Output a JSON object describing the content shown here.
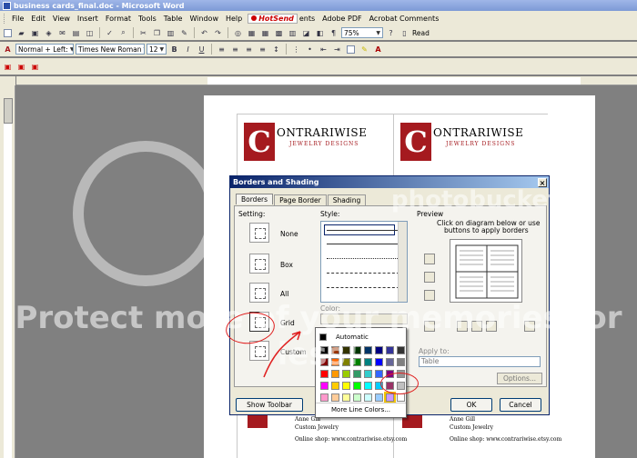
{
  "window": {
    "title": "business cards_final.doc - Microsoft Word"
  },
  "menu": {
    "items": [
      "File",
      "Edit",
      "View",
      "Insert",
      "Format",
      "Tools",
      "Table",
      "Window",
      "Help"
    ],
    "hotsend": "HotSend",
    "trailing": [
      "ents",
      "Adobe PDF",
      "Acrobat Comments"
    ]
  },
  "toolbar1": {
    "zoom": "75%",
    "read_label": "Read"
  },
  "toolbar2": {
    "style": "Normal + Left:",
    "font": "Times New Roman",
    "size": "12"
  },
  "document": {
    "card_logo_letter": "C",
    "card_brand": "ONTRARIWISE",
    "card_tagline": "JEWELRY DESIGNS",
    "bottom_left": [
      "Anne Gill",
      "Custom Jewelry",
      "",
      "Online shop: www.contrariwise.etsy.com"
    ],
    "bottom_right": [
      "Anne Gill",
      "Custom Jewelry",
      "",
      "Online shop: www.contrariwise.etsy.com"
    ]
  },
  "dialog": {
    "title": "Borders and Shading",
    "close": "×",
    "tabs": [
      "Borders",
      "Page Border",
      "Shading"
    ],
    "setting_label": "Setting:",
    "settings": [
      "None",
      "Box",
      "All",
      "Grid",
      "Custom"
    ],
    "style_label": "Style:",
    "color_label": "Color:",
    "preview_label": "Preview",
    "preview_hint": [
      "Click on diagram below or use",
      "buttons to apply borders"
    ],
    "apply_label": "Apply to:",
    "apply_value": "Table",
    "options_label": "Options...",
    "show_toolbar": "Show Toolbar",
    "ok": "OK",
    "cancel": "Cancel"
  },
  "palette": {
    "automatic": "Automatic",
    "more": "More Line Colors...",
    "colors": [
      "#000000",
      "#993300",
      "#333300",
      "#003300",
      "#003366",
      "#000080",
      "#333399",
      "#333333",
      "#800000",
      "#ff6600",
      "#808000",
      "#008000",
      "#008080",
      "#0000ff",
      "#666699",
      "#808080",
      "#ff0000",
      "#ff9900",
      "#99cc00",
      "#339966",
      "#33cccc",
      "#3366ff",
      "#800080",
      "#969696",
      "#ff00ff",
      "#ffcc00",
      "#ffff00",
      "#00ff00",
      "#00ffff",
      "#00ccff",
      "#993366",
      "#c0c0c0",
      "#ff99cc",
      "#ffcc99",
      "#ffff99",
      "#ccffcc",
      "#ccffff",
      "#99ccff",
      "#cc99ff",
      "#ffffff"
    ]
  },
  "watermark": {
    "text": "Protect more of your memories for less!",
    "brand": "photobucket"
  },
  "colors": {
    "accent": "#a51a1f",
    "annotation": "#e02020"
  }
}
